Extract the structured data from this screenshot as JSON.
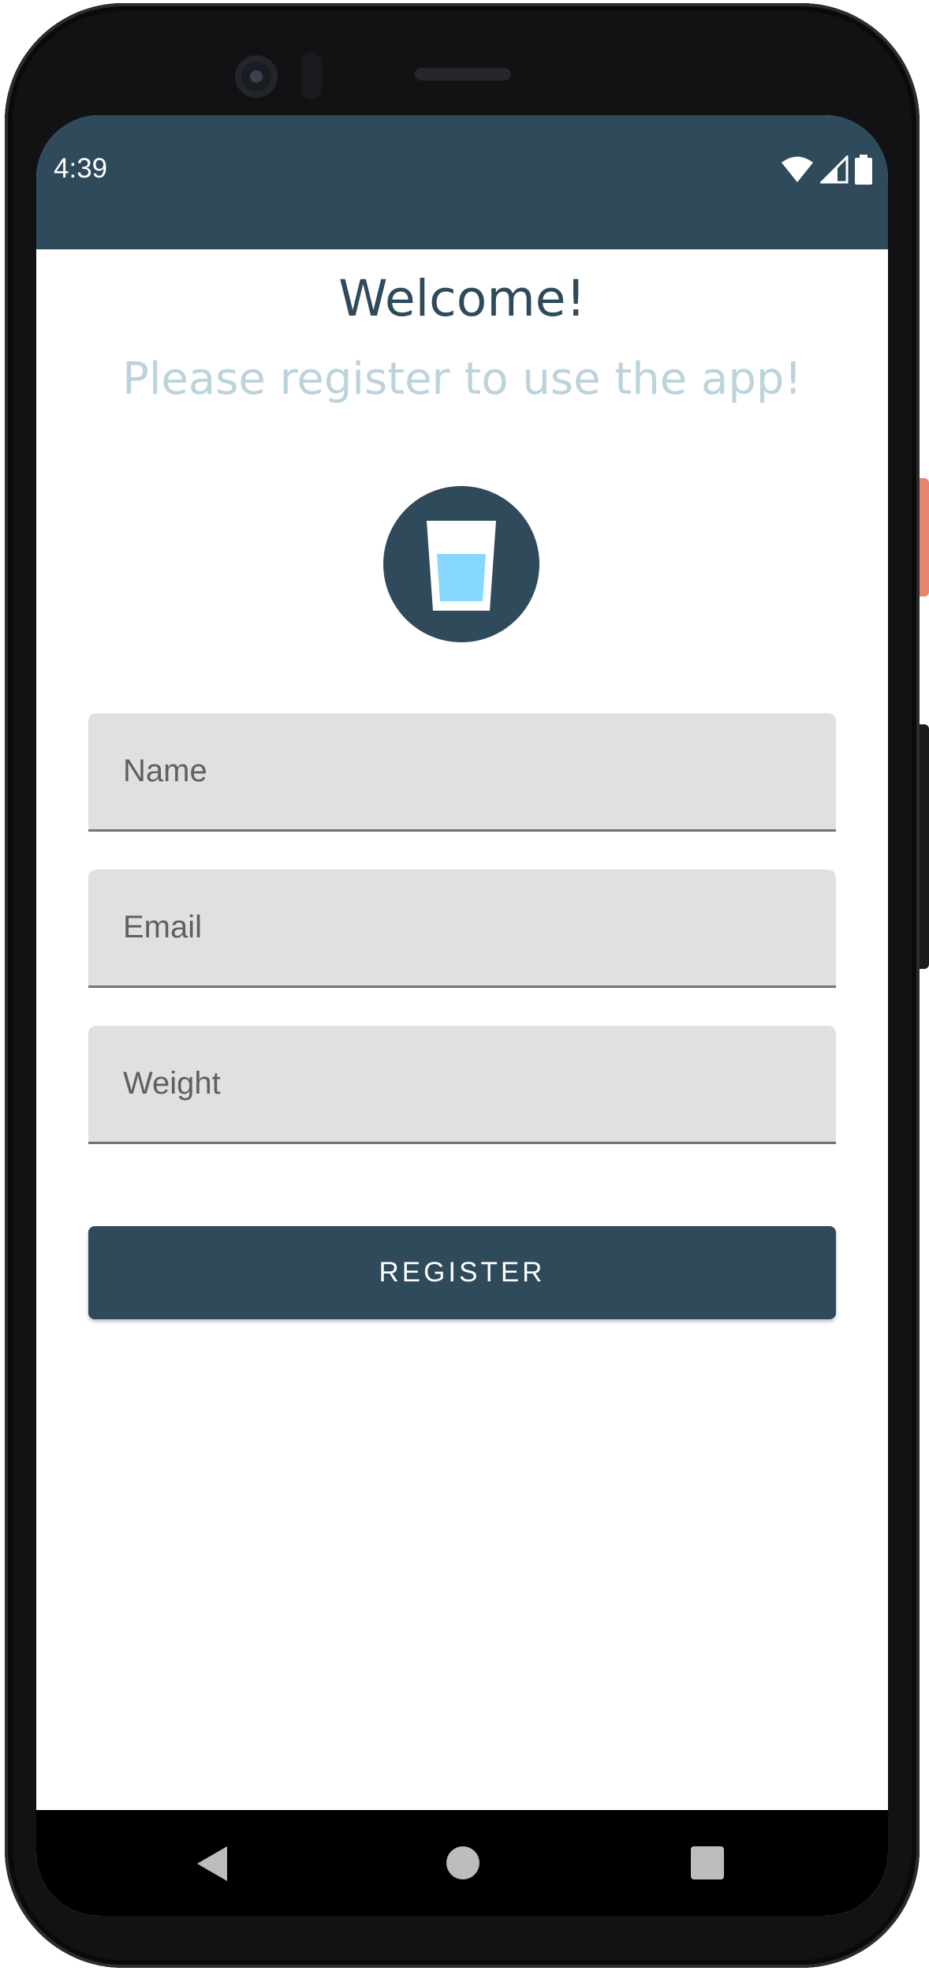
{
  "status_bar": {
    "time": "4:39",
    "icons": [
      "wifi-icon",
      "cell-signal-icon",
      "battery-icon"
    ],
    "color": "#2e4a5b"
  },
  "main": {
    "title": "Welcome!",
    "subtitle": "Please register to use the app!",
    "logo_icon": "water-glass-icon",
    "fields": {
      "name_placeholder": "Name",
      "email_placeholder": "Email",
      "weight_placeholder": "Weight"
    },
    "register_label": "REGISTER"
  },
  "nav_bar": {
    "icons": [
      "back-icon",
      "home-icon",
      "recents-icon"
    ]
  },
  "colors": {
    "primary": "#2e4a5b",
    "subtitle": "#bcd3dd",
    "field_bg": "#e0e0e0",
    "water": "#87d8ff"
  }
}
